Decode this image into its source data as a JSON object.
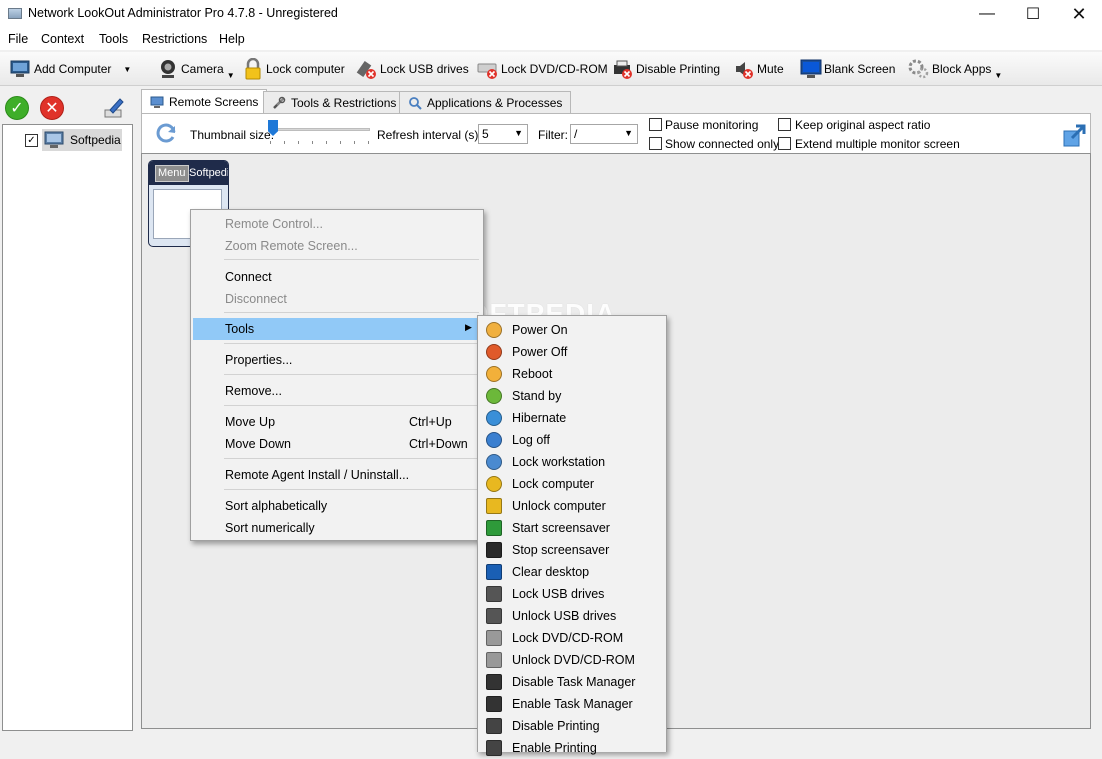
{
  "window": {
    "title": "Network LookOut Administrator Pro 4.7.8 - Unregistered"
  },
  "menubar": [
    "File",
    "Context",
    "Tools",
    "Restrictions",
    "Help"
  ],
  "toolbar": {
    "add_computer": "Add Computer",
    "camera": "Camera",
    "lock_computer": "Lock computer",
    "lock_usb": "Lock USB drives",
    "lock_dvd": "Lock DVD/CD-ROM",
    "disable_printing": "Disable Printing",
    "mute": "Mute",
    "blank_screen": "Blank Screen",
    "block_apps": "Block Apps"
  },
  "tree": {
    "computer": "Softpedia"
  },
  "tabs": [
    "Remote Screens",
    "Tools & Restrictions",
    "Applications & Processes"
  ],
  "screens_toolbar": {
    "thumbnail_label": "Thumbnail size:",
    "refresh_label": "Refresh interval (s):",
    "refresh_value": "5",
    "filter_label": "Filter:",
    "filter_value": "/",
    "pause_monitoring": "Pause monitoring",
    "show_connected": "Show connected only",
    "keep_aspect": "Keep original aspect ratio",
    "extend_monitor": "Extend multiple monitor screen"
  },
  "thumbnail": {
    "menu_button": "Menu",
    "name": "Softpedia"
  },
  "watermark": "SOFTPEDIA",
  "context_menu": {
    "remote_control": "Remote Control...",
    "zoom": "Zoom Remote Screen...",
    "connect": "Connect",
    "disconnect": "Disconnect",
    "tools": "Tools",
    "properties": "Properties...",
    "remove": "Remove...",
    "move_up": "Move Up",
    "move_up_key": "Ctrl+Up",
    "move_down": "Move Down",
    "move_down_key": "Ctrl+Down",
    "agent_install": "Remote Agent Install / Uninstall...",
    "sort_alpha": "Sort alphabetically",
    "sort_num": "Sort numerically"
  },
  "tools_submenu": [
    {
      "label": "Power On",
      "icon": "power-on-icon",
      "color": "#f0b040"
    },
    {
      "label": "Power Off",
      "icon": "power-off-icon",
      "color": "#e05a2a"
    },
    {
      "label": "Reboot",
      "icon": "reboot-icon",
      "color": "#f2b03a"
    },
    {
      "label": "Stand by",
      "icon": "standby-icon",
      "color": "#6cb83a"
    },
    {
      "label": "Hibernate",
      "icon": "hibernate-icon",
      "color": "#3a8fd8"
    },
    {
      "label": "Log off",
      "icon": "log-off-icon",
      "color": "#3a7fd0"
    },
    {
      "label": "Lock workstation",
      "icon": "lock-workstation-icon",
      "color": "#4a8ad0"
    },
    {
      "label": "Lock computer",
      "icon": "lock-icon",
      "color": "#e8b820"
    },
    {
      "label": "Unlock computer",
      "icon": "unlock-icon",
      "color": "#e8b820"
    },
    {
      "label": "Start screensaver",
      "icon": "start-screensaver-icon",
      "color": "#2e9a3a"
    },
    {
      "label": "Stop screensaver",
      "icon": "stop-screensaver-icon",
      "color": "#2a2a2a"
    },
    {
      "label": "Clear desktop",
      "icon": "clear-desktop-icon",
      "color": "#1a5fb4"
    },
    {
      "label": "Lock USB drives",
      "icon": "lock-usb-icon",
      "color": "#555555"
    },
    {
      "label": "Unlock USB drives",
      "icon": "unlock-usb-icon",
      "color": "#555555"
    },
    {
      "label": "Lock DVD/CD-ROM",
      "icon": "lock-dvd-icon",
      "color": "#999999"
    },
    {
      "label": "Unlock DVD/CD-ROM",
      "icon": "unlock-dvd-icon",
      "color": "#999999"
    },
    {
      "label": "Disable Task Manager",
      "icon": "disable-task-manager-icon",
      "color": "#333333"
    },
    {
      "label": "Enable Task Manager",
      "icon": "enable-task-manager-icon",
      "color": "#333333"
    },
    {
      "label": "Disable Printing",
      "icon": "disable-printing-icon",
      "color": "#444444"
    },
    {
      "label": "Enable Printing",
      "icon": "enable-printing-icon",
      "color": "#444444"
    }
  ]
}
